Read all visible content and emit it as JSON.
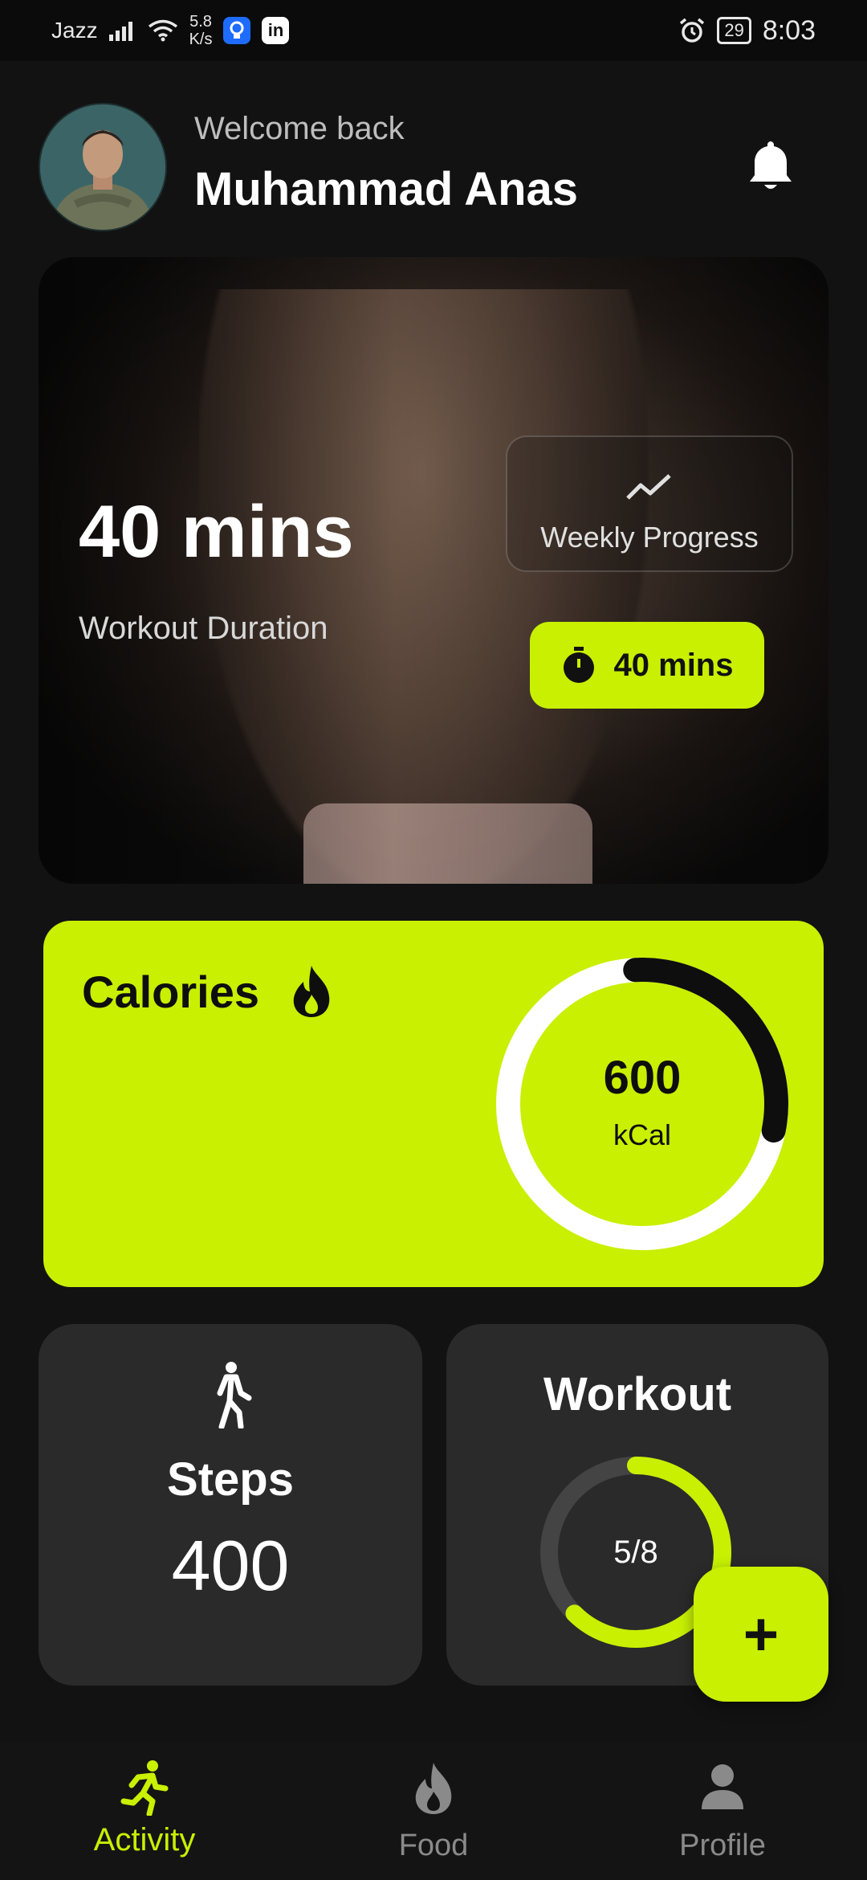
{
  "status_bar": {
    "carrier": "Jazz",
    "speed_value": "5.8",
    "speed_unit": "K/s",
    "battery": "29",
    "time": "8:03"
  },
  "header": {
    "welcome": "Welcome back",
    "username": "Muhammad Anas"
  },
  "hero": {
    "duration_value": "40 mins",
    "duration_label": "Workout Duration",
    "weekly_progress_label": "Weekly Progress",
    "timer_label": "40 mins"
  },
  "calories": {
    "title": "Calories",
    "value": "600",
    "unit": "kCal",
    "progress_fraction": 0.29
  },
  "steps": {
    "title": "Steps",
    "value": "400"
  },
  "workout": {
    "title": "Workout",
    "progress_text": "5/8",
    "progress_fraction": 0.625
  },
  "fab": {
    "label": "+"
  },
  "nav": {
    "items": [
      {
        "label": "Activity",
        "icon": "running-icon",
        "active": true
      },
      {
        "label": "Food",
        "icon": "flame-icon",
        "active": false
      },
      {
        "label": "Profile",
        "icon": "person-icon",
        "active": false
      }
    ]
  },
  "colors": {
    "accent": "#c8f000",
    "background": "#121212",
    "card": "#2a2a2a"
  }
}
